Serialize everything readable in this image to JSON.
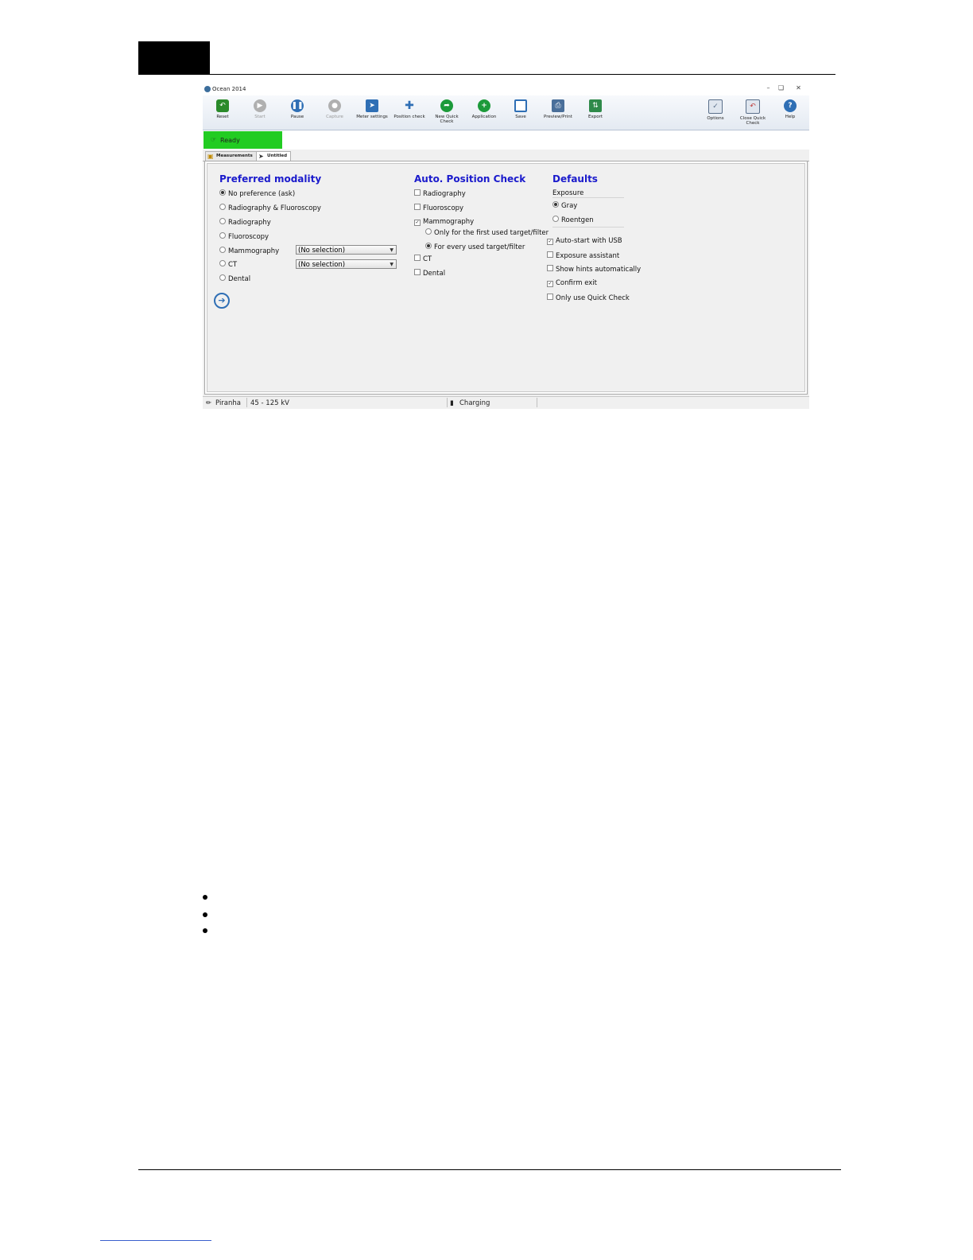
{
  "window": {
    "title": "Ocean 2014",
    "controls": [
      "minimize-icon",
      "restore-icon",
      "close-icon"
    ]
  },
  "toolbar": {
    "buttons": [
      {
        "label": "Reset",
        "icon": "reset-icon",
        "color": "#2a8a2a",
        "enabled": true
      },
      {
        "label": "Start",
        "icon": "play-icon",
        "color": "#b0b0b0",
        "enabled": false
      },
      {
        "label": "Pause",
        "icon": "pause-icon",
        "color": "#2f6fb5",
        "enabled": true
      },
      {
        "label": "Capture",
        "icon": "capture-icon",
        "color": "#b0b0b0",
        "enabled": false
      },
      {
        "label": "Meter settings",
        "icon": "meter-settings-icon",
        "color": "#2f6fb5",
        "enabled": true
      },
      {
        "label": "Position check",
        "icon": "crosshair-icon",
        "color": "#2f6fb5",
        "enabled": true
      },
      {
        "label": "New Quick Check",
        "icon": "new-quick-check-icon",
        "color": "#1c9a3a",
        "enabled": true
      },
      {
        "label": "Application",
        "icon": "add-application-icon",
        "color": "#1c9a3a",
        "enabled": true
      },
      {
        "label": "Save",
        "icon": "save-icon",
        "color": "#2f6fb5",
        "enabled": true
      },
      {
        "label": "Preview/Print",
        "icon": "print-icon",
        "color": "#4a6f9a",
        "enabled": true
      },
      {
        "label": "Export",
        "icon": "export-icon",
        "color": "#2f8a4a",
        "enabled": true
      },
      {
        "label": "Options",
        "icon": "options-icon",
        "color": "#5a6f8a",
        "enabled": true
      },
      {
        "label": "Close Quick Check",
        "icon": "close-quick-check-icon",
        "color": "#c04040",
        "enabled": true
      },
      {
        "label": "Help",
        "icon": "help-icon",
        "color": "#2f6fb5",
        "enabled": true
      }
    ]
  },
  "status": {
    "ready": "Ready",
    "ready_color": "#22cc22"
  },
  "tabs": [
    {
      "label": "Measurements",
      "active": false
    },
    {
      "label": "Untitled",
      "active": true
    }
  ],
  "preferred_modality": {
    "heading": "Preferred modality",
    "options": [
      {
        "label": "No preference (ask)",
        "selected": true
      },
      {
        "label": "Radiography & Fluoroscopy",
        "selected": false
      },
      {
        "label": "Radiography",
        "selected": false
      },
      {
        "label": "Fluoroscopy",
        "selected": false
      },
      {
        "label": "Mammography",
        "selected": false
      },
      {
        "label": "CT",
        "selected": false
      },
      {
        "label": "Dental",
        "selected": false
      }
    ],
    "mammography_select": "(No selection)",
    "ct_select": "(No selection)"
  },
  "auto_position_check": {
    "heading": "Auto. Position Check",
    "items": [
      {
        "label": "Radiography",
        "checked": false
      },
      {
        "label": "Fluoroscopy",
        "checked": false
      },
      {
        "label": "Mammography",
        "checked": true
      },
      {
        "label": "CT",
        "checked": false
      },
      {
        "label": "Dental",
        "checked": false
      }
    ],
    "mammo_suboptions": [
      {
        "label": "Only for the first used target/filter",
        "selected": false
      },
      {
        "label": "For every used target/filter",
        "selected": true
      }
    ]
  },
  "defaults": {
    "heading": "Defaults",
    "exposure_label": "Exposure",
    "exposure_options": [
      {
        "label": "Gray",
        "selected": true
      },
      {
        "label": "Roentgen",
        "selected": false
      }
    ],
    "checks": [
      {
        "label": "Auto-start with USB",
        "checked": true
      },
      {
        "label": "Exposure assistant",
        "checked": false
      },
      {
        "label": "Show hints automatically",
        "checked": false
      },
      {
        "label": "Confirm exit",
        "checked": true
      },
      {
        "label": "Only use Quick Check",
        "checked": false
      }
    ]
  },
  "statusbar": {
    "device": "Piranha",
    "range": "45 - 125 kV",
    "battery": "Charging"
  }
}
